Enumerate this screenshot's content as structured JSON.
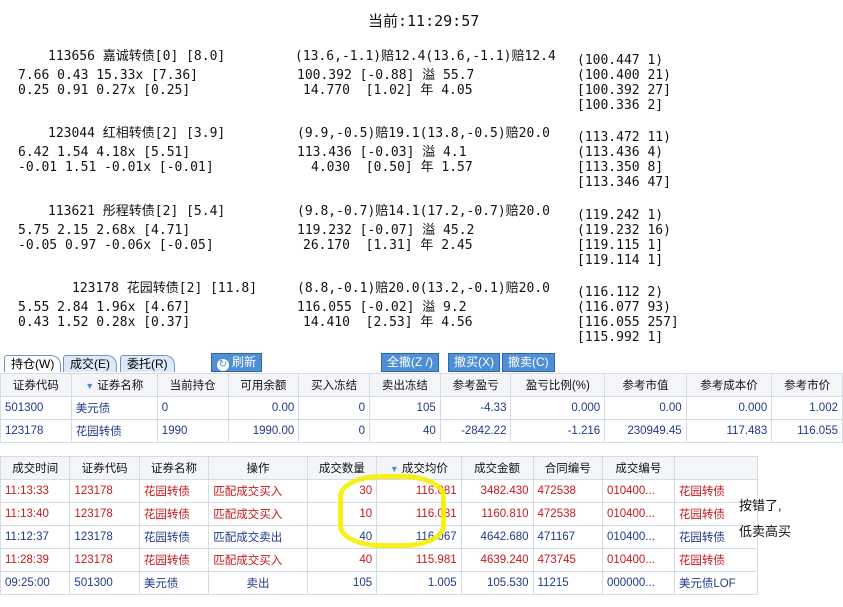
{
  "clock": "当前:11:29:57",
  "quotes": [
    {
      "line1": "113656 嘉诚转债[0] [8.0]",
      "line2": "7.66 0.43 15.33x [7.36]",
      "line3": "0.25 0.91 0.27x [0.25]",
      "mid1": "(13.6,-1.1)赔12.4(13.6,-1.1)赔12.4",
      "mid2": "100.392 [-0.88] 溢 55.7",
      "mid3": "14.770  [1.02] 年 4.05",
      "book": [
        "(100.447 1)",
        "(100.400 21)",
        "[100.392 27]",
        "[100.336 2]"
      ]
    },
    {
      "line1": "123044 红相转债[2] [3.9]",
      "line2": "6.42 1.54 4.18x [5.51]",
      "line3": "-0.01 1.51 -0.01x [-0.01]",
      "mid1": "(9.9,-0.5)赔19.1(13.8,-0.5)赔20.0",
      "mid2": "113.436 [-0.03] 溢 4.1",
      "mid3": "4.030  [0.50] 年 1.57",
      "book": [
        "(113.472 11)",
        "(113.436 4)",
        "[113.350 8]",
        "[113.346 47]"
      ]
    },
    {
      "line1": "113621 彤程转债[2] [5.4]",
      "line2": "5.75 2.15 2.68x [4.71]",
      "line3": "-0.05 0.97 -0.06x [-0.05]",
      "mid1": "(9.8,-0.7)赔14.1(17.2,-0.7)赔20.0",
      "mid2": "119.232 [-0.07] 溢 45.2",
      "mid3": "26.170  [1.31] 年 2.45",
      "book": [
        "(119.242 1)",
        "(119.232 16)",
        "[119.115 1]",
        "[119.114 1]"
      ]
    },
    {
      "line1": "123178 花园转债[2] [11.8]",
      "line2": "5.55 2.84 1.96x [4.67]",
      "line3": "0.43 1.52 0.28x [0.37]",
      "mid1": "(8.8,-0.1)赔20.0(13.2,-0.1)赔20.0",
      "mid2": "116.055 [-0.02] 溢 9.2",
      "mid3": "14.410  [2.53] 年 4.56",
      "book": [
        "(116.112 2)",
        "(116.077 93)",
        "[116.055 257]",
        "[115.992 1]"
      ]
    }
  ],
  "tabs": {
    "position": "持仓(W)",
    "trades": "成交(E)",
    "orders": "委托(R)"
  },
  "toolbar": {
    "refresh": "刷新",
    "cancel_all": "全撤(Z /)",
    "cancel_buy": "撤买(X)",
    "cancel_sell": "撤卖(C)"
  },
  "holdings": {
    "headers": [
      "证券代码",
      "证券名称",
      "当前持仓",
      "可用余额",
      "买入冻结",
      "卖出冻结",
      "参考盈亏",
      "盈亏比例(%)",
      "参考市值",
      "参考成本价",
      "参考市价"
    ],
    "rows": [
      [
        "501300",
        "美元债",
        "0",
        "0.00",
        "0",
        "105",
        "-4.33",
        "0.000",
        "0.00",
        "0.000",
        "1.002"
      ],
      [
        "123178",
        "花园转债",
        "1990",
        "1990.00",
        "0",
        "40",
        "-2842.22",
        "-1.216",
        "230949.45",
        "117.483",
        "116.055"
      ]
    ]
  },
  "trades": {
    "headers": [
      "成交时间",
      "证券代码",
      "证券名称",
      "操作",
      "成交数量",
      "成交均价",
      "成交金额",
      "合同编号",
      "成交编号",
      ""
    ],
    "rows": [
      [
        "11:13:33",
        "123178",
        "花园转债",
        "匹配成交买入",
        "30",
        "116.081",
        "3482.430",
        "472538",
        "010400...",
        "花园转债"
      ],
      [
        "11:13:40",
        "123178",
        "花园转债",
        "匹配成交买入",
        "10",
        "116.081",
        "1160.810",
        "472538",
        "010400...",
        "花园转债"
      ],
      [
        "11:12:37",
        "123178",
        "花园转债",
        "匹配成交卖出",
        "40",
        "116.067",
        "4642.680",
        "471167",
        "010400...",
        "花园转债"
      ],
      [
        "11:28:39",
        "123178",
        "花园转债",
        "匹配成交买入",
        "40",
        "115.981",
        "4639.240",
        "473745",
        "010400...",
        "花园转债"
      ],
      [
        "09:25:00",
        "501300",
        "美元债",
        "卖出",
        "105",
        "1.005",
        "105.530",
        "11215",
        "000000...",
        "美元债LOF"
      ]
    ]
  },
  "note": {
    "line1": "按错了,",
    "line2": "低卖高买"
  },
  "colors": {
    "accent": "#4f8fd6",
    "buy_text": "#c8171f",
    "normal_text": "#1f3a8a",
    "highlight": "#f5ef00"
  }
}
